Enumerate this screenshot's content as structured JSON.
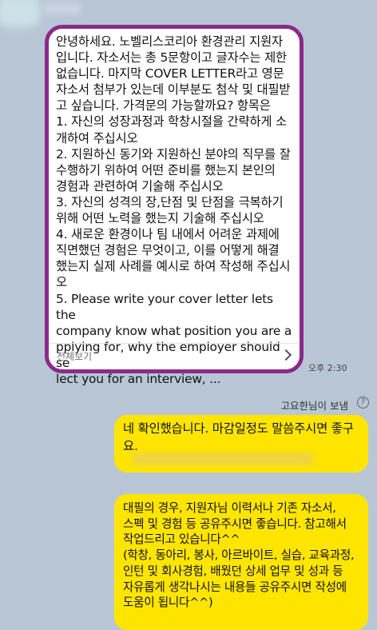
{
  "incoming": {
    "message": "안녕하세요. 노벨리스코리아 환경관리 지원자\n입니다. 자소서는 총 5문항이고 글자수는 제한\n없습니다. 마지막 COVER LETTER라고 영문\n자소서 첨부가 있는데 이부분도 첨삭 및 대필받\n고 싶습니다. 가격문의 가능할까요? 항목은\n1. 자신의 성장과정과 학창시절을 간략하게 소\n개하여 주십시오\n2. 지원하신 동기와 지원하신 분야의 직무를 잘\n 수행하기 위하여 어떤 준비를 했는지 본인의\n경험과 관련하여 기술해 주십시오\n3. 자신의 성격의 장,단점 및 단점을 극복하기\n위해 어떤 노력을 했는지 기술해 주십시오\n4. 새로운 환경이나 팀 내에서 어려운 과제에\n직면했던 경험은 무엇이고, 이를 어떻게 해결\n했는지 실제 사례를 예시로 하여 작성해 주십시\n오\n5. Please write your cover letter lets the\n company know what position you are a\npplying for, why the employer should se\nlect you for an interview, ...",
    "view_all_label": "전체보기",
    "time": "오후 2:30"
  },
  "sender_label": "고요한님이 보냄",
  "outgoing": [
    {
      "text": "네 확인했습니다. 마감일정도 말씀주시면 좋구\n요."
    },
    {
      "text": "대필의 경우, 지원자님 이력서나 기존 자소서,\n스펙 및 경험 등 공유주시면 좋습니다. 참고해서\n작업드리고 있습니다^^\n(학창, 동아리, 봉사, 아르바이트, 실습, 교육과정,\n인턴 및 회사경험, 배웠던 상세 업무 및 성과 등\n자유롭게 생각나시는 내용들 공유주시면 작성에\n도움이 됩니다^^)"
    }
  ],
  "colors": {
    "background": "#b9c6d6",
    "outgoing_bubble": "#fee500",
    "highlight_border": "#8a2a8a"
  }
}
